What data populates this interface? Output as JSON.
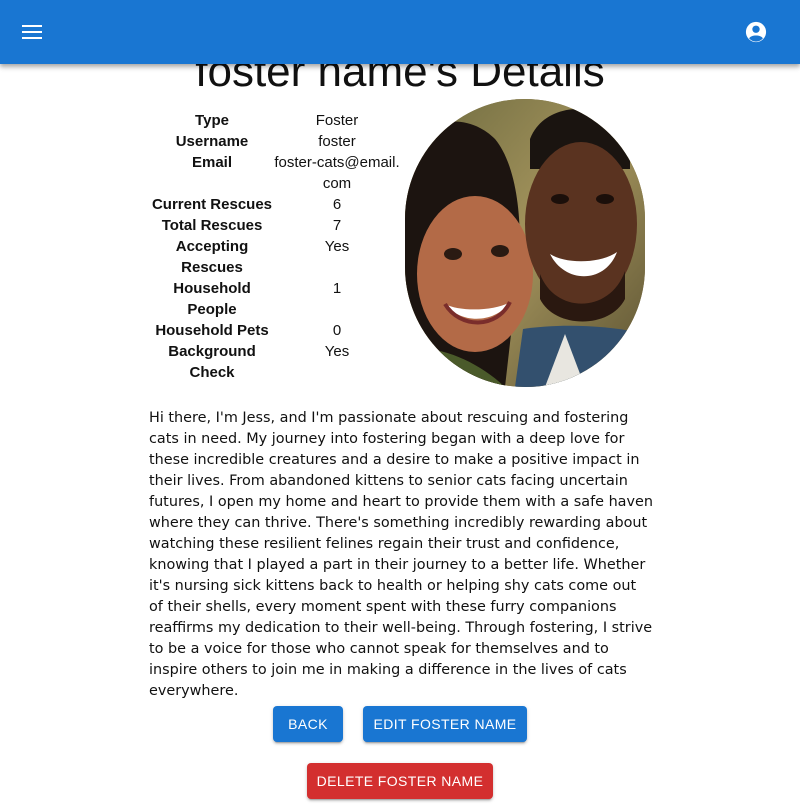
{
  "app_bar": {
    "menu_icon": "menu-icon",
    "account_icon": "account-circle-icon",
    "color": "#1976d2"
  },
  "page": {
    "title": "foster name's Details"
  },
  "details": [
    {
      "label": "Type",
      "value": "Foster"
    },
    {
      "label": "Username",
      "value": "foster"
    },
    {
      "label": "Email",
      "value": "foster-cats@email.com"
    },
    {
      "label": "Current Rescues",
      "value": "6"
    },
    {
      "label": "Total Rescues",
      "value": "7"
    },
    {
      "label": "Accepting Rescues",
      "value": "Yes"
    },
    {
      "label": "Household People",
      "value": "1"
    },
    {
      "label": "Household Pets",
      "value": "0"
    },
    {
      "label": "Background Check",
      "value": "Yes"
    }
  ],
  "bio": "Hi there, I'm Jess, and I'm passionate about rescuing and fostering cats in need. My journey into fostering began with a deep love for these incredible creatures and a desire to make a positive impact in their lives. From abandoned kittens to senior cats facing uncertain futures, I open my home and heart to provide them with a safe haven where they can thrive. There's something incredibly rewarding about watching these resilient felines regain their trust and confidence, knowing that I played a part in their journey to a better life. Whether it's nursing sick kittens back to health or helping shy cats come out of their shells, every moment spent with these furry companions reaffirms my dedication to their well-being. Through fostering, I strive to be a voice for those who cannot speak for themselves and to inspire others to join me in making a difference in the lives of cats everywhere.",
  "actions": {
    "back_label": "Back",
    "edit_label": "Edit foster name",
    "delete_label": "Delete foster name",
    "primary_color": "#1976d2",
    "danger_color": "#d32f2f"
  }
}
